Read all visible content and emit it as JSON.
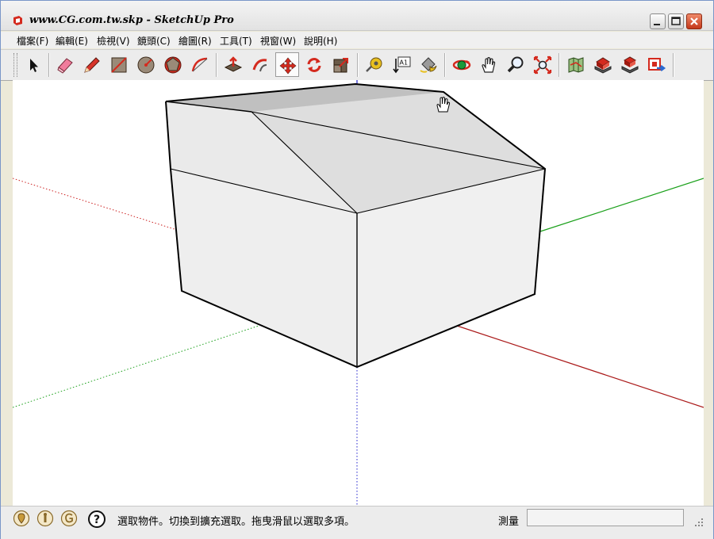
{
  "window": {
    "title": "www.CG.com.tw.skp - SketchUp Pro",
    "app_icon": "sketchup-logo-icon",
    "controls": {
      "minimize": "minimize-icon",
      "maximize": "maximize-icon",
      "close": "close-icon"
    }
  },
  "menu": {
    "items": [
      {
        "label": "檔案(F)"
      },
      {
        "label": "編輯(E)"
      },
      {
        "label": "檢視(V)"
      },
      {
        "label": "鏡頭(C)"
      },
      {
        "label": "繪圖(R)"
      },
      {
        "label": "工具(T)"
      },
      {
        "label": "視窗(W)"
      },
      {
        "label": "說明(H)"
      }
    ]
  },
  "toolbar": {
    "tools": [
      {
        "name": "select-tool",
        "icon": "arrow-cursor-icon",
        "active": false
      },
      {
        "name": "eraser-tool",
        "icon": "eraser-icon",
        "active": false
      },
      {
        "name": "pencil-tool",
        "icon": "pencil-icon",
        "active": false
      },
      {
        "name": "rectangle-tool",
        "icon": "rectangle-icon",
        "active": false
      },
      {
        "name": "circle-tool",
        "icon": "circle-icon",
        "active": false
      },
      {
        "name": "polygon-tool",
        "icon": "polygon-icon",
        "active": false
      },
      {
        "name": "arc-tool",
        "icon": "arc-icon",
        "active": false
      },
      {
        "name": "push-pull-tool",
        "icon": "push-pull-icon",
        "active": false
      },
      {
        "name": "follow-me-tool",
        "icon": "follow-me-icon",
        "active": false
      },
      {
        "name": "move-tool",
        "icon": "move-arrows-icon",
        "active": true
      },
      {
        "name": "rotate-tool",
        "icon": "rotate-icon",
        "active": false
      },
      {
        "name": "scale-tool",
        "icon": "scale-icon",
        "active": false
      },
      {
        "name": "tape-measure-tool",
        "icon": "tape-measure-icon",
        "active": false
      },
      {
        "name": "text-tool",
        "icon": "text-label-icon",
        "label": "A1",
        "active": false
      },
      {
        "name": "paint-bucket-tool",
        "icon": "paint-bucket-icon",
        "active": false
      },
      {
        "name": "orbit-tool",
        "icon": "orbit-icon",
        "active": false
      },
      {
        "name": "pan-tool",
        "icon": "hand-icon",
        "active": false
      },
      {
        "name": "zoom-tool",
        "icon": "magnifier-icon",
        "active": false
      },
      {
        "name": "zoom-extents-tool",
        "icon": "zoom-extents-icon",
        "active": false
      },
      {
        "name": "google-earth-tool",
        "icon": "map-icon",
        "active": false
      },
      {
        "name": "3d-warehouse-get-tool",
        "icon": "warehouse-get-icon",
        "active": false
      },
      {
        "name": "3d-warehouse-share-tool",
        "icon": "warehouse-share-icon",
        "active": false
      },
      {
        "name": "send-to-layout-tool",
        "icon": "send-to-layout-icon",
        "active": false
      }
    ]
  },
  "status": {
    "icons": [
      "geo-location-icon",
      "credits-icon",
      "user-icon",
      "help-icon"
    ],
    "help_glyph": "?",
    "message": "選取物件。切換到擴充選取。拖曳滑鼠以選取多項。",
    "measure_label": "測量",
    "measure_value": ""
  },
  "colors": {
    "axis_red": "#cc2020",
    "axis_green": "#1aa01a",
    "axis_blue": "#2020cc",
    "face_light": "#f0f0f0",
    "face_roof": "#dcdcdc",
    "face_top": "#c0c0c0",
    "edge": "#000000"
  },
  "viewport": {
    "model": "box-with-sloped-roof",
    "cursor": "hand-cursor-icon"
  }
}
